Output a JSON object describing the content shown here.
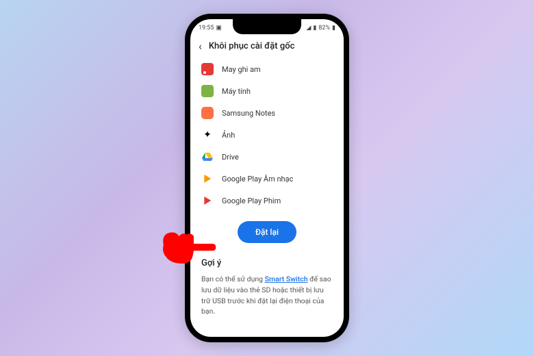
{
  "status": {
    "time": "19:55",
    "battery": "82%"
  },
  "header": {
    "title": "Khôi phục cài đặt gốc"
  },
  "apps": [
    {
      "label": "May ghi am"
    },
    {
      "label": "Máy tính"
    },
    {
      "label": "Samsung Notes"
    },
    {
      "label": "Ảnh"
    },
    {
      "label": "Drive"
    },
    {
      "label": "Google Play Âm nhạc"
    },
    {
      "label": "Google Play Phim"
    }
  ],
  "reset_button": "Đặt lại",
  "hint": {
    "title": "Gợi ý",
    "text_before": "Bạn có thể sử dụng ",
    "link": "Smart Switch",
    "text_after": " để sao lưu dữ liệu vào thẻ SD hoặc thiết bị lưu trữ USB trước khi đặt lại điện thoại của bạn."
  }
}
